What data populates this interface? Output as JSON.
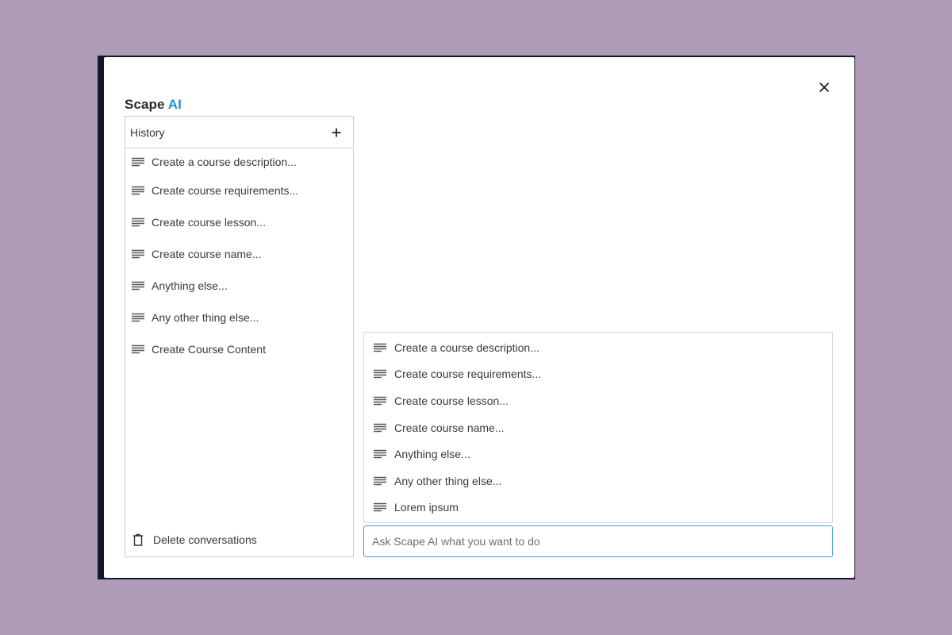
{
  "app": {
    "title_prefix": "Scape",
    "title_accent": "AI",
    "accent_color": "#1f8fd6",
    "close_icon": "close-icon"
  },
  "history": {
    "header_label": "History",
    "add_icon": "plus-icon",
    "items": [
      {
        "label": "Create a course description...",
        "icon": "lines-icon"
      },
      {
        "label": "Create course requirements...",
        "icon": "lines-icon"
      },
      {
        "label": "Create course lesson...",
        "icon": "lines-icon"
      },
      {
        "label": "Create course name...",
        "icon": "lines-icon"
      },
      {
        "label": "Anything else...",
        "icon": "lines-icon"
      },
      {
        "label": "Any other thing else...",
        "icon": "lines-icon"
      },
      {
        "label": "Create Course Content",
        "icon": "lines-icon"
      }
    ],
    "delete_label": "Delete conversations",
    "delete_icon": "trash-icon"
  },
  "suggestions": {
    "items": [
      {
        "label": "Create a course description...",
        "icon": "lines-icon"
      },
      {
        "label": "Create course requirements...",
        "icon": "lines-icon"
      },
      {
        "label": "Create course lesson...",
        "icon": "lines-icon"
      },
      {
        "label": "Create course name...",
        "icon": "lines-icon"
      },
      {
        "label": "Anything else...",
        "icon": "lines-icon"
      },
      {
        "label": "Any other thing else...",
        "icon": "lines-icon"
      },
      {
        "label": "Lorem ipsum",
        "icon": "lines-icon"
      }
    ]
  },
  "prompt": {
    "value": "",
    "placeholder": "Ask Scape AI what you want to do",
    "focus_color": "#3aa5c4"
  }
}
